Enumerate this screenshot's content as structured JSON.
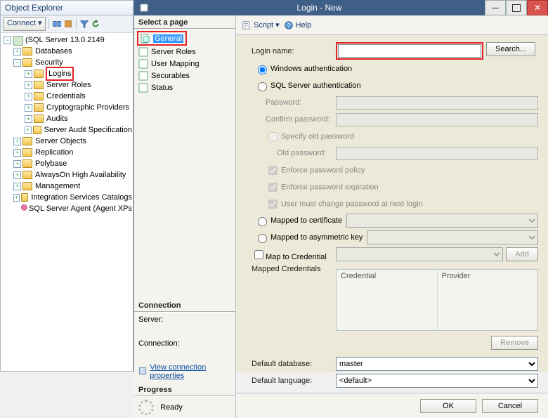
{
  "explorer": {
    "title": "Object Explorer",
    "connect_label": "Connect",
    "root": "(SQL Server 13.0.2149",
    "nodes": {
      "databases": "Databases",
      "security": "Security",
      "logins": "Logins",
      "server_roles": "Server Roles",
      "credentials": "Credentials",
      "crypto": "Cryptographic Providers",
      "audits": "Audits",
      "audit_spec": "Server Audit Specification",
      "server_objects": "Server Objects",
      "replication": "Replication",
      "polybase": "Polybase",
      "alwayson": "AlwaysOn High Availability",
      "management": "Management",
      "is_catalogs": "Integration Services Catalogs",
      "agent": "SQL Server Agent (Agent XPs"
    }
  },
  "dialog": {
    "title": "Login - New",
    "pages_header": "Select a page",
    "pages": {
      "general": "General",
      "server_roles": "Server Roles",
      "user_mapping": "User Mapping",
      "securables": "Securables",
      "status": "Status"
    },
    "connection_header": "Connection",
    "server_label": "Server:",
    "connection_label": "Connection:",
    "view_props": "View connection properties",
    "progress_header": "Progress",
    "progress_status": "Ready",
    "toolbar": {
      "script": "Script",
      "help": "Help"
    },
    "form": {
      "login_name": "Login name:",
      "login_value": "",
      "search": "Search...",
      "win_auth": "Windows authentication",
      "sql_auth": "SQL Server authentication",
      "password": "Password:",
      "confirm": "Confirm password:",
      "specify_old": "Specify old password",
      "old_password": "Old password:",
      "enforce_policy": "Enforce password policy",
      "enforce_expire": "Enforce password expiration",
      "must_change": "User must change password at next login",
      "mapped_cert": "Mapped to certificate",
      "mapped_asym": "Mapped to asymmetric key",
      "map_cred": "Map to Credential",
      "add": "Add",
      "mapped_creds": "Mapped Credentials",
      "cred_col": "Credential",
      "prov_col": "Provider",
      "remove": "Remove",
      "def_db": "Default database:",
      "def_db_value": "master",
      "def_lang": "Default language:",
      "def_lang_value": "<default>",
      "ok": "OK",
      "cancel": "Cancel"
    }
  }
}
